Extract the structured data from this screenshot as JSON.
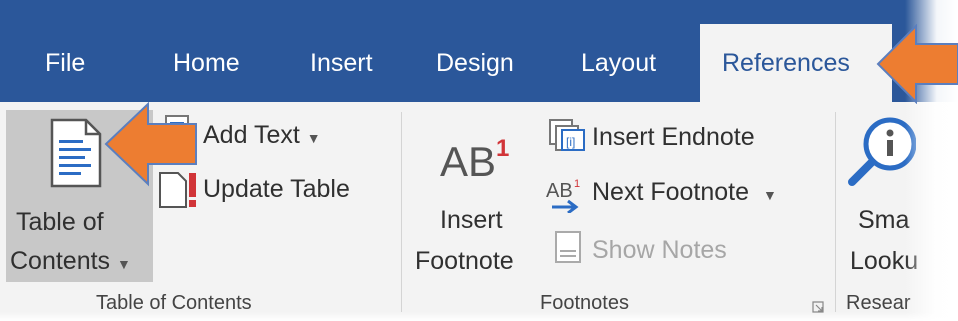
{
  "tabs": [
    "File",
    "Home",
    "Insert",
    "Design",
    "Layout"
  ],
  "active_tab": "References",
  "toc": {
    "button_line1": "Table of",
    "button_line2": "Contents",
    "add_text": "Add Text",
    "update_table": "Update Table",
    "group_label": "Table of Contents"
  },
  "footnotes": {
    "insert_line1": "Insert",
    "insert_line2": "Footnote",
    "icon_text": "AB",
    "icon_superscript": "1",
    "insert_endnote": "Insert Endnote",
    "next_footnote": "Next Footnote",
    "show_notes": "Show Notes",
    "group_label": "Footnotes"
  },
  "research": {
    "smart_line1": "Sma",
    "smart_line2": "Looku",
    "group_label": "Resear"
  },
  "colors": {
    "ribbon_blue": "#2b579a",
    "ribbon_bg": "#f3f3f3",
    "arrow_orange": "#ed7d31"
  }
}
